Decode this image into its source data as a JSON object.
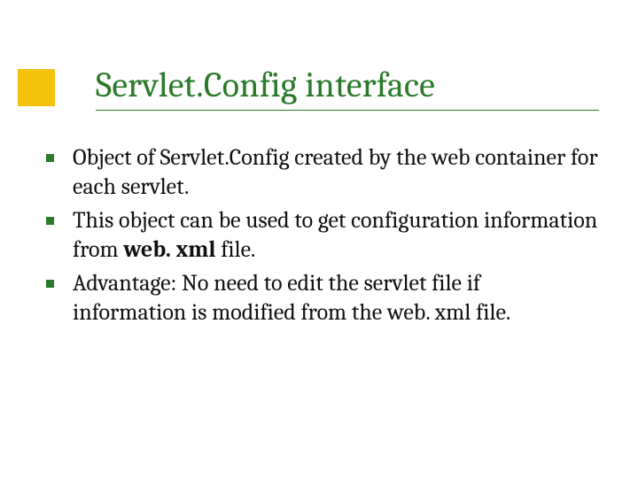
{
  "title": "Servlet.Config interface",
  "bullets": [
    {
      "pre": "Object of Servlet.Config created by the web container for each servlet.",
      "bold": "",
      "post": ""
    },
    {
      "pre": "This object can be used to get configuration information from ",
      "bold": "web. xml",
      "post": " file."
    },
    {
      "pre": "Advantage: No need to edit the servlet file if information is modified from the web. xml file.",
      "bold": "",
      "post": ""
    }
  ],
  "colors": {
    "accent": "#f4c20d",
    "title": "#2a7a2a",
    "bullet": "#2a7a2a"
  }
}
